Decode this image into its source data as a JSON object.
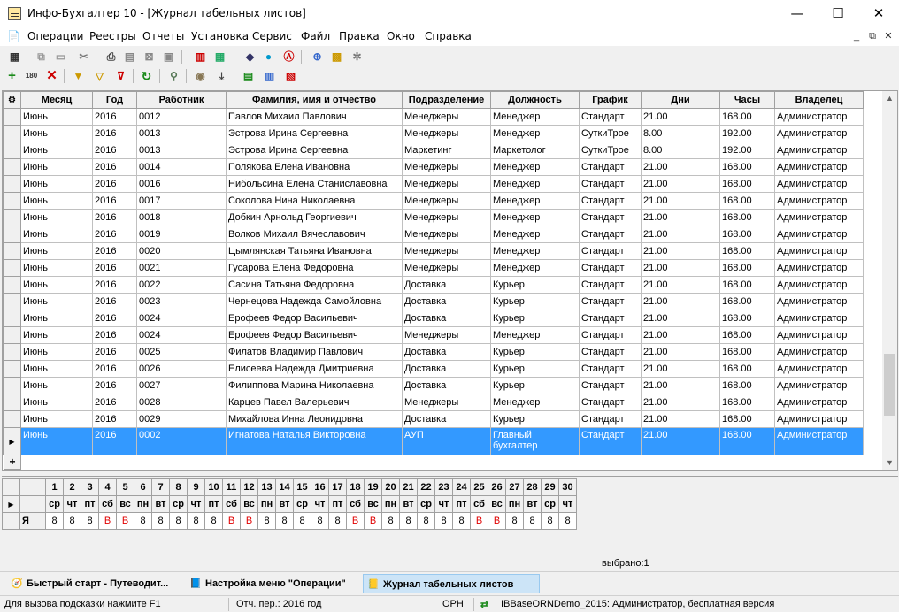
{
  "window": {
    "title": "Инфо-Бухгалтер 10 - [Журнал табельных листов]",
    "min": "—",
    "max": "☐",
    "close": "✕"
  },
  "menu": [
    "Операции",
    "Реестры",
    "Отчеты",
    "Установка",
    "Сервис",
    "Файл",
    "Правка",
    "Окно",
    "Справка"
  ],
  "mdi": {
    "min": "_",
    "restore": "⧉",
    "close": "✕"
  },
  "grid": {
    "columns": [
      "Месяц",
      "Год",
      "Работник",
      "Фамилия, имя и отчество",
      "Подразделение",
      "Должность",
      "График",
      "Дни",
      "Часы",
      "Владелец"
    ],
    "rows": [
      [
        "Июнь",
        "2016",
        "0012",
        "Павлов Михаил Павлович",
        "Менеджеры",
        "Менеджер",
        "Стандарт",
        "21.00",
        "168.00",
        "Администратор"
      ],
      [
        "Июнь",
        "2016",
        "0013",
        "Эстрова Ирина Сергеевна",
        "Менеджеры",
        "Менеджер",
        "СуткиТрое",
        "8.00",
        "192.00",
        "Администратор"
      ],
      [
        "Июнь",
        "2016",
        "0013",
        "Эстрова Ирина Сергеевна",
        "Маркетинг",
        "Маркетолог",
        "СуткиТрое",
        "8.00",
        "192.00",
        "Администратор"
      ],
      [
        "Июнь",
        "2016",
        "0014",
        "Полякова Елена Ивановна",
        "Менеджеры",
        "Менеджер",
        "Стандарт",
        "21.00",
        "168.00",
        "Администратор"
      ],
      [
        "Июнь",
        "2016",
        "0016",
        "Нибольсина Елена Станиславовна",
        "Менеджеры",
        "Менеджер",
        "Стандарт",
        "21.00",
        "168.00",
        "Администратор"
      ],
      [
        "Июнь",
        "2016",
        "0017",
        "Соколова Нина Николаевна",
        "Менеджеры",
        "Менеджер",
        "Стандарт",
        "21.00",
        "168.00",
        "Администратор"
      ],
      [
        "Июнь",
        "2016",
        "0018",
        "Добкин Арнольд Георгиевич",
        "Менеджеры",
        "Менеджер",
        "Стандарт",
        "21.00",
        "168.00",
        "Администратор"
      ],
      [
        "Июнь",
        "2016",
        "0019",
        "Волков Михаил Вячеславович",
        "Менеджеры",
        "Менеджер",
        "Стандарт",
        "21.00",
        "168.00",
        "Администратор"
      ],
      [
        "Июнь",
        "2016",
        "0020",
        "Цымлянская Татьяна Ивановна",
        "Менеджеры",
        "Менеджер",
        "Стандарт",
        "21.00",
        "168.00",
        "Администратор"
      ],
      [
        "Июнь",
        "2016",
        "0021",
        "Гусарова Елена Федоровна",
        "Менеджеры",
        "Менеджер",
        "Стандарт",
        "21.00",
        "168.00",
        "Администратор"
      ],
      [
        "Июнь",
        "2016",
        "0022",
        "Сасина Татьяна Федоровна",
        "Доставка",
        "Курьер",
        "Стандарт",
        "21.00",
        "168.00",
        "Администратор"
      ],
      [
        "Июнь",
        "2016",
        "0023",
        "Чернецова Надежда Самойловна",
        "Доставка",
        "Курьер",
        "Стандарт",
        "21.00",
        "168.00",
        "Администратор"
      ],
      [
        "Июнь",
        "2016",
        "0024",
        "Ерофеев Федор Васильевич",
        "Доставка",
        "Курьер",
        "Стандарт",
        "21.00",
        "168.00",
        "Администратор"
      ],
      [
        "Июнь",
        "2016",
        "0024",
        "Ерофеев Федор Васильевич",
        "Менеджеры",
        "Менеджер",
        "Стандарт",
        "21.00",
        "168.00",
        "Администратор"
      ],
      [
        "Июнь",
        "2016",
        "0025",
        "Филатов Владимир Павлович",
        "Доставка",
        "Курьер",
        "Стандарт",
        "21.00",
        "168.00",
        "Администратор"
      ],
      [
        "Июнь",
        "2016",
        "0026",
        "Елисеева Надежда Дмитриевна",
        "Доставка",
        "Курьер",
        "Стандарт",
        "21.00",
        "168.00",
        "Администратор"
      ],
      [
        "Июнь",
        "2016",
        "0027",
        "Филиппова Марина Николаевна",
        "Доставка",
        "Курьер",
        "Стандарт",
        "21.00",
        "168.00",
        "Администратор"
      ],
      [
        "Июнь",
        "2016",
        "0028",
        "Карцев Павел Валерьевич",
        "Менеджеры",
        "Менеджер",
        "Стандарт",
        "21.00",
        "168.00",
        "Администратор"
      ],
      [
        "Июнь",
        "2016",
        "0029",
        "Михайлова Инна Леонидовна",
        "Доставка",
        "Курьер",
        "Стандарт",
        "21.00",
        "168.00",
        "Администратор"
      ]
    ],
    "selected_row": [
      "Июнь",
      "2016",
      "0002",
      "Игнатова Наталья Викторовна",
      "АУП",
      "Главный бухгалтер",
      "Стандарт",
      "21.00",
      "168.00",
      "Администратор"
    ],
    "new_row": "+"
  },
  "calendar": {
    "days": [
      "1",
      "2",
      "3",
      "4",
      "5",
      "6",
      "7",
      "8",
      "9",
      "10",
      "11",
      "12",
      "13",
      "14",
      "15",
      "16",
      "17",
      "18",
      "19",
      "20",
      "21",
      "22",
      "23",
      "24",
      "25",
      "26",
      "27",
      "28",
      "29",
      "30"
    ],
    "weekdays": [
      "ср",
      "чт",
      "пт",
      "сб",
      "вс",
      "пн",
      "вт",
      "ср",
      "чт",
      "пт",
      "сб",
      "вс",
      "пн",
      "вт",
      "ср",
      "чт",
      "пт",
      "сб",
      "вс",
      "пн",
      "вт",
      "ср",
      "чт",
      "пт",
      "сб",
      "вс",
      "пн",
      "вт",
      "ср",
      "чт"
    ],
    "row_label": "Я",
    "values": [
      "8",
      "8",
      "8",
      "В",
      "В",
      "8",
      "8",
      "8",
      "8",
      "8",
      "В",
      "В",
      "8",
      "8",
      "8",
      "8",
      "8",
      "В",
      "В",
      "8",
      "8",
      "8",
      "8",
      "8",
      "В",
      "В",
      "8",
      "8",
      "8",
      "8"
    ]
  },
  "selected_label": "выбрано:1",
  "tabs": [
    {
      "label": "Быстрый старт - Путеводит...",
      "icon": "compass-icon"
    },
    {
      "label": "Настройка меню \"Операции\"",
      "icon": "document-icon"
    },
    {
      "label": "Журнал табельных листов",
      "icon": "journal-icon"
    }
  ],
  "status": {
    "hint": "Для вызова подсказки нажмите F1",
    "period": "Отч. пер.: 2016 год",
    "org": "ОРН",
    "db": "IBBaseORNDemo_2015: Администратор, бесплатная версия"
  }
}
